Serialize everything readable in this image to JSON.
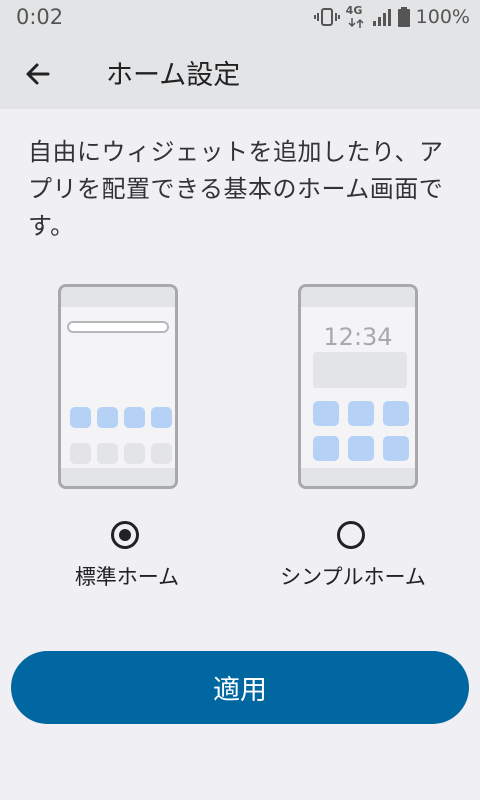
{
  "status_bar": {
    "time": "0:02",
    "network": "4G",
    "battery": "100%"
  },
  "app_bar": {
    "title": "ホーム設定",
    "back_icon": "arrow-back-icon"
  },
  "description": "自由にウィジェットを追加したり、アプリを配置できる基本のホーム画面です。",
  "options": [
    {
      "label": "標準ホーム",
      "selected": true
    },
    {
      "label": "シンプルホーム",
      "selected": false,
      "preview_clock": "12:34"
    }
  ],
  "apply_button": {
    "label": "適用"
  },
  "colors": {
    "accent": "#0067a0",
    "app_icon_blue": "#b6d1f6",
    "app_icon_grey": "#e3e4e6",
    "background": "#efeff4"
  }
}
